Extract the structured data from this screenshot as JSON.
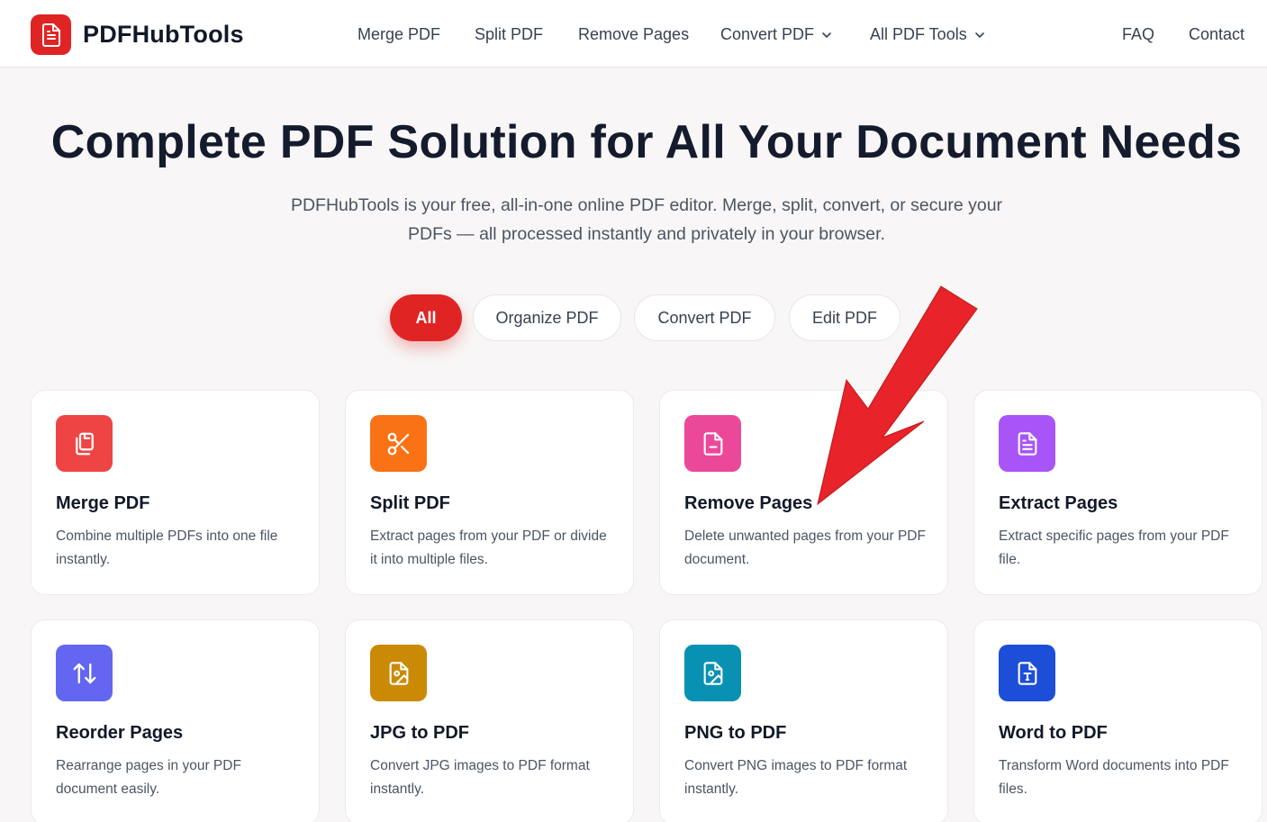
{
  "brand": {
    "name": "PDFHubTools",
    "accent": "#e02424"
  },
  "nav": {
    "items": [
      {
        "label": "Merge PDF",
        "dropdown": false
      },
      {
        "label": "Split PDF",
        "dropdown": false
      },
      {
        "label": "Remove Pages",
        "dropdown": false
      },
      {
        "label": "Convert PDF",
        "dropdown": true
      },
      {
        "label": "All PDF Tools",
        "dropdown": true
      }
    ],
    "right": [
      {
        "label": "FAQ"
      },
      {
        "label": "Contact"
      }
    ]
  },
  "hero": {
    "title": "Complete PDF Solution for All Your Document Needs",
    "subtitle": "PDFHubTools is your free, all-in-one online PDF editor. Merge, split, convert, or secure your PDFs — all processed instantly and privately in your browser."
  },
  "filters": [
    {
      "label": "All",
      "active": true
    },
    {
      "label": "Organize PDF",
      "active": false
    },
    {
      "label": "Convert PDF",
      "active": false
    },
    {
      "label": "Edit PDF",
      "active": false
    }
  ],
  "tools": [
    {
      "title": "Merge PDF",
      "desc": "Combine multiple PDFs into one file instantly.",
      "icon": "copy-icon",
      "color": "#ef4444"
    },
    {
      "title": "Split PDF",
      "desc": "Extract pages from your PDF or divide it into multiple files.",
      "icon": "scissors-icon",
      "color": "#f97316"
    },
    {
      "title": "Remove Pages",
      "desc": "Delete unwanted pages from your PDF document.",
      "icon": "file-minus-icon",
      "color": "#ec4899"
    },
    {
      "title": "Extract Pages",
      "desc": "Extract specific pages from your PDF file.",
      "icon": "file-text-icon",
      "color": "#a855f7"
    },
    {
      "title": "Reorder Pages",
      "desc": "Rearrange pages in your PDF document easily.",
      "icon": "arrows-up-down-icon",
      "color": "#6366f1"
    },
    {
      "title": "JPG to PDF",
      "desc": "Convert JPG images to PDF format instantly.",
      "icon": "file-image-icon",
      "color": "#ca8a04"
    },
    {
      "title": "PNG to PDF",
      "desc": "Convert PNG images to PDF format instantly.",
      "icon": "file-image-icon",
      "color": "#0891b2"
    },
    {
      "title": "Word to PDF",
      "desc": "Transform Word documents into PDF files.",
      "icon": "file-type-icon",
      "color": "#1d4ed8"
    }
  ],
  "annotation": {
    "icon": "red-arrow-icon",
    "color": "#e8232a"
  }
}
